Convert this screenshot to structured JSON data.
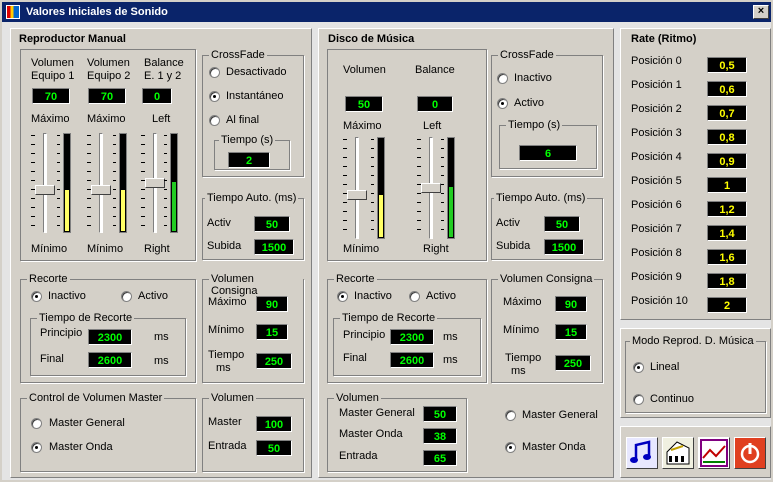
{
  "window": {
    "title": "Valores Iniciales de Sonido",
    "close": "×"
  },
  "manual": {
    "title": "Reproductor Manual",
    "col1": {
      "h1": "Volumen",
      "h2": "Equipo 1",
      "value": "70",
      "top": "Máximo",
      "bottom": "Mínimo",
      "level": 0.42
    },
    "col2": {
      "h1": "Volumen",
      "h2": "Equipo 2",
      "value": "70",
      "top": "Máximo",
      "bottom": "Mínimo",
      "level": 0.42
    },
    "col3": {
      "h1": "Balance",
      "h2": "E. 1 y 2",
      "value": "0",
      "top": "Left",
      "bottom": "Right",
      "level": 0.5
    },
    "crossfade": {
      "title": "CrossFade",
      "opt1": "Desactivado",
      "opt2": "Instantáneo",
      "opt3": "Al final",
      "selected": 2,
      "tiempo_title": "Tiempo (s)",
      "tiempo": "2"
    },
    "auto": {
      "title": "Tiempo Auto. (ms)",
      "activ_label": "Activ",
      "activ": "50",
      "subida_label": "Subida",
      "subida": "1500"
    },
    "recorte": {
      "title": "Recorte",
      "opt1": "Inactivo",
      "opt2": "Activo",
      "selected": 1,
      "tr_title": "Tiempo de Recorte",
      "principio_label": "Principio",
      "principio": "2300",
      "final_label": "Final",
      "final": "2600",
      "unit": "ms"
    },
    "consigna": {
      "title": "Volumen Consigna",
      "max_label": "Máximo",
      "max": "90",
      "min_label": "Mínimo",
      "min": "15",
      "t1": "Tiempo",
      "t2": "ms",
      "tiempo": "250"
    },
    "master": {
      "title": "Control de Volumen Master",
      "opt1": "Master General",
      "opt2": "Master Onda",
      "selected": 2
    },
    "volumen": {
      "title": "Volumen",
      "master_label": "Master",
      "master": "100",
      "entrada_label": "Entrada",
      "entrada": "50"
    }
  },
  "disco": {
    "title": "Disco de Música",
    "col1": {
      "h1": "Volumen",
      "value": "50",
      "top": "Máximo",
      "bottom": "Mínimo",
      "level": 0.42
    },
    "col2": {
      "h1": "Balance",
      "value": "0",
      "top": "Left",
      "bottom": "Right",
      "level": 0.5
    },
    "crossfade": {
      "title": "CrossFade",
      "opt1": "Inactivo",
      "opt2": "Activo",
      "selected": 2,
      "tiempo_title": "Tiempo (s)",
      "tiempo": "6"
    },
    "auto": {
      "title": "Tiempo Auto. (ms)",
      "activ_label": "Activ",
      "activ": "50",
      "subida_label": "Subida",
      "subida": "1500"
    },
    "recorte": {
      "title": "Recorte",
      "opt1": "Inactivo",
      "opt2": "Activo",
      "selected": 1,
      "tr_title": "Tiempo de Recorte",
      "principio_label": "Principio",
      "principio": "2300",
      "final_label": "Final",
      "final": "2600",
      "unit": "ms"
    },
    "consigna": {
      "title": "Volumen Consigna",
      "max_label": "Máximo",
      "max": "90",
      "min_label": "Mínimo",
      "min": "15",
      "t1": "Tiempo",
      "t2": "ms",
      "tiempo": "250"
    },
    "volumen": {
      "title": "Volumen",
      "mg_label": "Master General",
      "mg": "50",
      "mo_label": "Master Onda",
      "mo": "38",
      "en_label": "Entrada",
      "en": "65"
    },
    "master": {
      "opt1": "Master General",
      "opt2": "Master Onda",
      "selected": 2
    }
  },
  "rate": {
    "title": "Rate (Ritmo)",
    "items": [
      {
        "label": "Posición  0",
        "value": "0,5"
      },
      {
        "label": "Posición  1",
        "value": "0,6"
      },
      {
        "label": "Posición  2",
        "value": "0,7"
      },
      {
        "label": "Posición  3",
        "value": "0,8"
      },
      {
        "label": "Posición  4",
        "value": "0,9"
      },
      {
        "label": "Posición  5",
        "value": "1"
      },
      {
        "label": "Posición  6",
        "value": "1,2"
      },
      {
        "label": "Posición  7",
        "value": "1,4"
      },
      {
        "label": "Posición  8",
        "value": "1,6"
      },
      {
        "label": "Posición  9",
        "value": "1,8"
      },
      {
        "label": "Posición 10",
        "value": "2"
      }
    ]
  },
  "modo": {
    "title": "Modo Reprod. D. Música",
    "opt1": "Lineal",
    "opt2": "Continuo",
    "selected": 1
  },
  "toolbar": {
    "icons": [
      "music-note-icon",
      "piano-icon",
      "chart-icon",
      "power-icon"
    ]
  },
  "colors": {
    "value_text": "#00ff00",
    "rate_text": "#ffff00",
    "title_bar": "#0a246a",
    "meter_yellow": "#ffff66",
    "meter_green": "#22cc22"
  }
}
